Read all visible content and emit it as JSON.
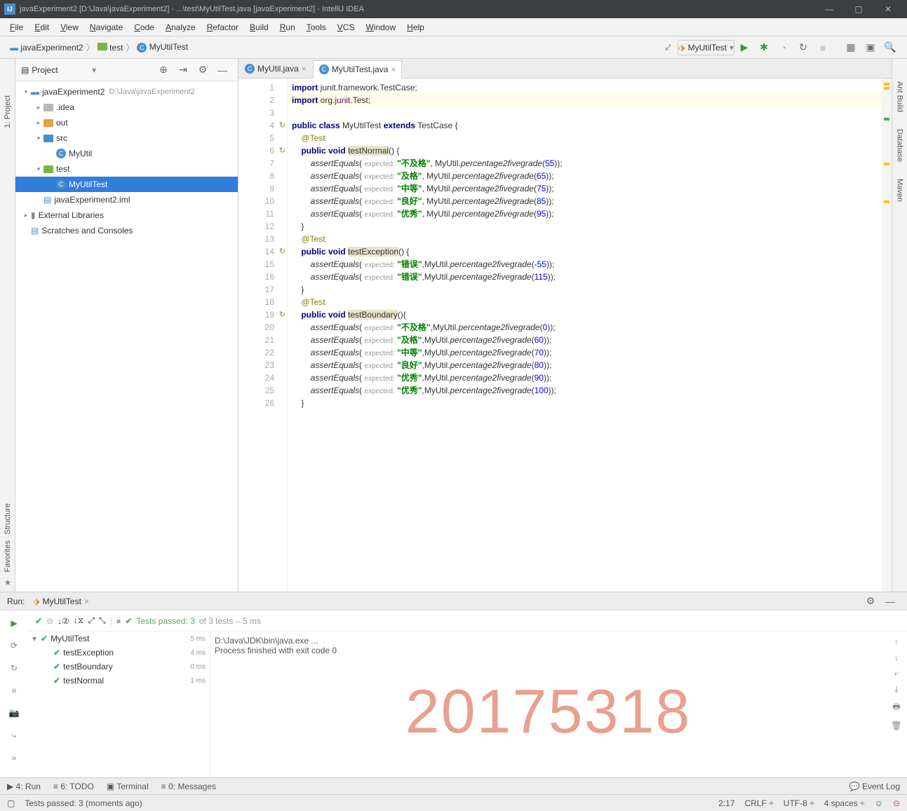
{
  "titlebar": {
    "title": "javaExperiment2 [D:\\Java\\javaExperiment2] - ...\\test\\MyUtilTest.java [javaExperiment2] - IntelliJ IDEA"
  },
  "menubar": [
    "File",
    "Edit",
    "View",
    "Navigate",
    "Code",
    "Analyze",
    "Refactor",
    "Build",
    "Run",
    "Tools",
    "VCS",
    "Window",
    "Help"
  ],
  "breadcrumbs": [
    {
      "label": "javaExperiment2",
      "type": "root"
    },
    {
      "label": "test",
      "type": "folder"
    },
    {
      "label": "MyUtilTest",
      "type": "class"
    }
  ],
  "run_config": "MyUtilTest",
  "project_panel": {
    "title": "Project",
    "tree": [
      {
        "depth": 0,
        "arrow": "▾",
        "icon": "root",
        "label": "javaExperiment2",
        "hint": "D:\\Java\\javaExperiment2"
      },
      {
        "depth": 1,
        "arrow": "▸",
        "icon": "folder",
        "label": ".idea"
      },
      {
        "depth": 1,
        "arrow": "▸",
        "icon": "folder-orange",
        "label": "out"
      },
      {
        "depth": 1,
        "arrow": "▾",
        "icon": "folder-blue",
        "label": "src"
      },
      {
        "depth": 2,
        "arrow": "",
        "icon": "class",
        "label": "MyUtil"
      },
      {
        "depth": 1,
        "arrow": "▾",
        "icon": "folder-green",
        "label": "test"
      },
      {
        "depth": 2,
        "arrow": "",
        "icon": "class",
        "label": "MyUtilTest",
        "selected": true
      },
      {
        "depth": 1,
        "arrow": "",
        "icon": "iml",
        "label": "javaExperiment2.iml"
      },
      {
        "depth": 0,
        "arrow": "▸",
        "icon": "lib",
        "label": "External Libraries"
      },
      {
        "depth": 0,
        "arrow": "",
        "icon": "scratch",
        "label": "Scratches and Consoles"
      }
    ]
  },
  "editor": {
    "tabs": [
      {
        "label": "MyUtil.java",
        "active": false
      },
      {
        "label": "MyUtilTest.java",
        "active": true
      }
    ],
    "code": [
      {
        "n": 1,
        "html": "<span class='kw'>import</span> junit.framework.TestCase;"
      },
      {
        "n": 2,
        "html": "<span class='kw'>import</span> org.<span style='color:#660e7a'>junit</span>.Test;",
        "bg": "#fffbe6"
      },
      {
        "n": 3,
        "html": ""
      },
      {
        "n": 4,
        "html": "<span class='kw'>public class</span> MyUtilTest <span class='kw'>extends</span> TestCase {",
        "run": true
      },
      {
        "n": 5,
        "html": "    <span class='ann'>@Test</span>"
      },
      {
        "n": 6,
        "html": "    <span class='kw'>public void</span> <span class='hl'>testNormal</span>() {",
        "run": true
      },
      {
        "n": 7,
        "html": "        <span class='fn'>assertEquals</span>( <span class='param'>expected:</span> <span class='str'>\"不及格\"</span>, MyUtil.<span class='fn'>percentage2fivegrade</span>(<span class='num'>55</span>));"
      },
      {
        "n": 8,
        "html": "        <span class='fn'>assertEquals</span>( <span class='param'>expected:</span> <span class='str'>\"及格\"</span>, MyUtil.<span class='fn'>percentage2fivegrade</span>(<span class='num'>65</span>));"
      },
      {
        "n": 9,
        "html": "        <span class='fn'>assertEquals</span>( <span class='param'>expected:</span> <span class='str'>\"中等\"</span>, MyUtil.<span class='fn'>percentage2fivegrade</span>(<span class='num'>75</span>));"
      },
      {
        "n": 10,
        "html": "        <span class='fn'>assertEquals</span>( <span class='param'>expected:</span> <span class='str'>\"良好\"</span>, MyUtil.<span class='fn'>percentage2fivegrade</span>(<span class='num'>85</span>));"
      },
      {
        "n": 11,
        "html": "        <span class='fn'>assertEquals</span>( <span class='param'>expected:</span> <span class='str'>\"优秀\"</span>, MyUtil.<span class='fn'>percentage2fivegrade</span>(<span class='num'>95</span>));"
      },
      {
        "n": 12,
        "html": "    }"
      },
      {
        "n": 13,
        "html": "    <span class='ann'>@Test</span>"
      },
      {
        "n": 14,
        "html": "    <span class='kw'>public void</span> <span class='hl'>testException</span>() {",
        "run": true
      },
      {
        "n": 15,
        "html": "        <span class='fn'>assertEquals</span>( <span class='param'>expected:</span> <span class='str'>\"错误\"</span>,MyUtil.<span class='fn'>percentage2fivegrade</span>(<span class='num'>-55</span>));"
      },
      {
        "n": 16,
        "html": "        <span class='fn'>assertEquals</span>( <span class='param'>expected:</span> <span class='str'>\"错误\"</span>,MyUtil.<span class='fn'>percentage2fivegrade</span>(<span class='num'>115</span>));"
      },
      {
        "n": 17,
        "html": "    }"
      },
      {
        "n": 18,
        "html": "    <span class='ann'>@Test</span>"
      },
      {
        "n": 19,
        "html": "    <span class='kw'>public void</span> <span class='hl'>testBoundary</span>(){",
        "run": true
      },
      {
        "n": 20,
        "html": "        <span class='fn'>assertEquals</span>( <span class='param'>expected:</span> <span class='str'>\"不及格\"</span>,MyUtil.<span class='fn'>percentage2fivegrade</span>(<span class='num'>0</span>));"
      },
      {
        "n": 21,
        "html": "        <span class='fn'>assertEquals</span>( <span class='param'>expected:</span> <span class='str'>\"及格\"</span>,MyUtil.<span class='fn'>percentage2fivegrade</span>(<span class='num'>60</span>));"
      },
      {
        "n": 22,
        "html": "        <span class='fn'>assertEquals</span>( <span class='param'>expected:</span> <span class='str'>\"中等\"</span>,MyUtil.<span class='fn'>percentage2fivegrade</span>(<span class='num'>70</span>));"
      },
      {
        "n": 23,
        "html": "        <span class='fn'>assertEquals</span>( <span class='param'>expected:</span> <span class='str'>\"良好\"</span>,MyUtil.<span class='fn'>percentage2fivegrade</span>(<span class='num'>80</span>));"
      },
      {
        "n": 24,
        "html": "        <span class='fn'>assertEquals</span>( <span class='param'>expected:</span> <span class='str'>\"优秀\"</span>,MyUtil.<span class='fn'>percentage2fivegrade</span>(<span class='num'>90</span>));"
      },
      {
        "n": 25,
        "html": "        <span class='fn'>assertEquals</span>( <span class='param'>expected:</span> <span class='str'>\"优秀\"</span>,MyUtil.<span class='fn'>percentage2fivegrade</span>(<span class='num'>100</span>));"
      },
      {
        "n": 26,
        "html": "    }"
      }
    ]
  },
  "run": {
    "label": "Run:",
    "target": "MyUtilTest",
    "summary_pre": "Tests passed: 3",
    "summary_post": " of 3 tests – 5 ms",
    "tree": [
      {
        "depth": 0,
        "label": "MyUtilTest",
        "time": "5 ms",
        "arrow": "▾"
      },
      {
        "depth": 1,
        "label": "testException",
        "time": "4 ms"
      },
      {
        "depth": 1,
        "label": "testBoundary",
        "time": "0 ms"
      },
      {
        "depth": 1,
        "label": "testNormal",
        "time": "1 ms"
      }
    ],
    "output": [
      "D:\\Java\\JDK\\bin\\java.exe ...",
      "",
      "Process finished with exit code 0"
    ],
    "watermark": "20175318"
  },
  "toolwindows": [
    {
      "icon": "▶",
      "label": "4: Run"
    },
    {
      "icon": "≡",
      "label": "6: TODO"
    },
    {
      "icon": "▣",
      "label": "Terminal"
    },
    {
      "icon": "≡",
      "label": "0: Messages"
    }
  ],
  "eventlog": "Event Log",
  "status": {
    "msg": "Tests passed: 3 (moments ago)",
    "pos": "2:17",
    "le": "CRLF",
    "enc": "UTF-8",
    "indent": "4 spaces"
  },
  "side_right": [
    "Ant Build",
    "Database",
    "Maven"
  ],
  "side_left": [
    "1: Project"
  ],
  "side_left_bottom": [
    "Structure",
    "Favorites"
  ]
}
